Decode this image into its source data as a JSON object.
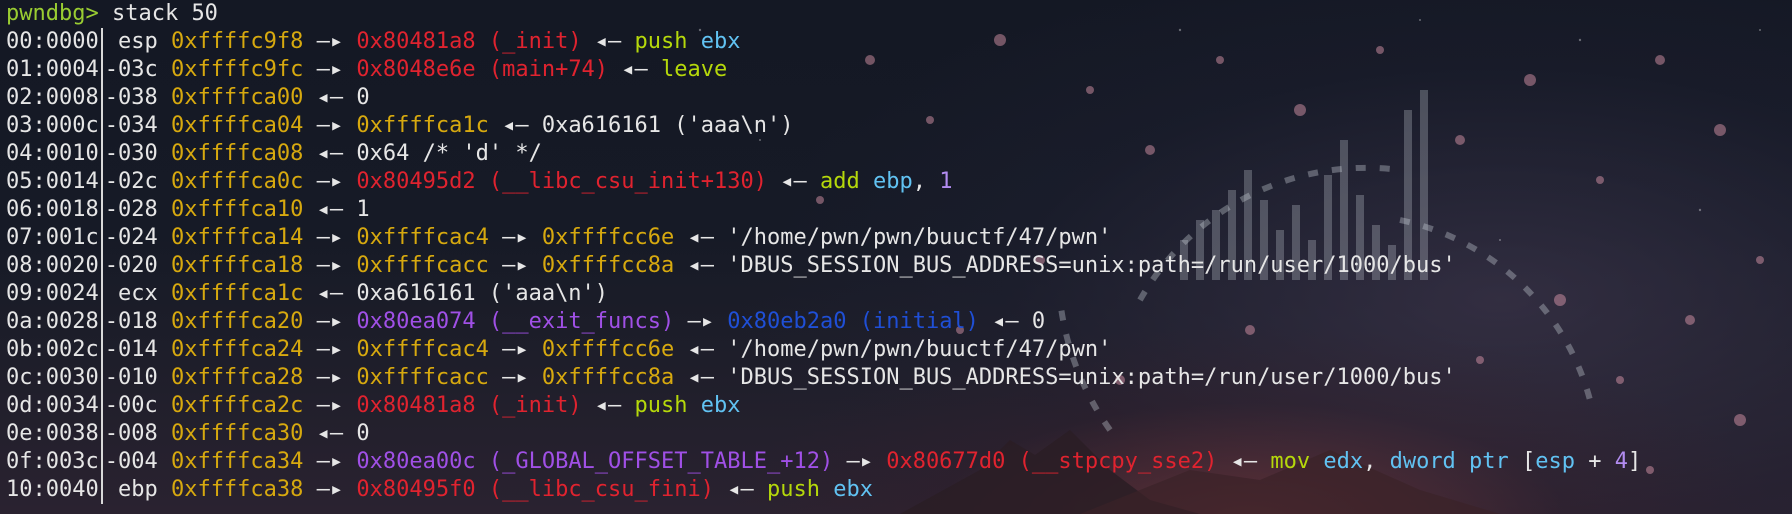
{
  "prompt": {
    "label": "pwndbg>",
    "command": "stack 50"
  },
  "rows": [
    {
      "idx": "00:0000",
      "off": " esp",
      "addr": "0xffffc9f8",
      "parts": [
        {
          "t": " —▸ ",
          "c": "white"
        },
        {
          "t": "0x80481a8 (_init)",
          "c": "red"
        },
        {
          "t": " ◂— ",
          "c": "white"
        },
        {
          "t": "push",
          "c": "lime"
        },
        {
          "t": " ",
          "c": "white"
        },
        {
          "t": "ebx",
          "c": "cyan"
        }
      ]
    },
    {
      "idx": "01:0004",
      "off": "-03c",
      "addr": "0xffffc9fc",
      "parts": [
        {
          "t": " —▸ ",
          "c": "white"
        },
        {
          "t": "0x8048e6e (main+74)",
          "c": "red"
        },
        {
          "t": " ◂— ",
          "c": "white"
        },
        {
          "t": "leave",
          "c": "lime"
        }
      ]
    },
    {
      "idx": "02:0008",
      "off": "-038",
      "addr": "0xffffca00",
      "parts": [
        {
          "t": " ◂— 0",
          "c": "white"
        }
      ]
    },
    {
      "idx": "03:000c",
      "off": "-034",
      "addr": "0xffffca04",
      "parts": [
        {
          "t": " —▸ ",
          "c": "white"
        },
        {
          "t": "0xffffca1c",
          "c": "yellow"
        },
        {
          "t": " ◂— 0xa616161 ('aaa\\n')",
          "c": "white"
        }
      ]
    },
    {
      "idx": "04:0010",
      "off": "-030",
      "addr": "0xffffca08",
      "parts": [
        {
          "t": " ◂— 0x64 /* 'd' */",
          "c": "white"
        }
      ]
    },
    {
      "idx": "05:0014",
      "off": "-02c",
      "addr": "0xffffca0c",
      "parts": [
        {
          "t": " —▸ ",
          "c": "white"
        },
        {
          "t": "0x80495d2 (__libc_csu_init+130)",
          "c": "red"
        },
        {
          "t": " ◂— ",
          "c": "white"
        },
        {
          "t": "add",
          "c": "lime"
        },
        {
          "t": " ",
          "c": "white"
        },
        {
          "t": "ebp",
          "c": "cyan"
        },
        {
          "t": ", ",
          "c": "white"
        },
        {
          "t": "1",
          "c": "lav"
        }
      ]
    },
    {
      "idx": "06:0018",
      "off": "-028",
      "addr": "0xffffca10",
      "parts": [
        {
          "t": " ◂— 1",
          "c": "white"
        }
      ]
    },
    {
      "idx": "07:001c",
      "off": "-024",
      "addr": "0xffffca14",
      "parts": [
        {
          "t": " —▸ ",
          "c": "white"
        },
        {
          "t": "0xffffcac4",
          "c": "yellow"
        },
        {
          "t": " —▸ ",
          "c": "white"
        },
        {
          "t": "0xffffcc6e",
          "c": "yellow"
        },
        {
          "t": " ◂— '/home/pwn/pwn/buuctf/47/pwn'",
          "c": "white"
        }
      ]
    },
    {
      "idx": "08:0020",
      "off": "-020",
      "addr": "0xffffca18",
      "parts": [
        {
          "t": " —▸ ",
          "c": "white"
        },
        {
          "t": "0xffffcacc",
          "c": "yellow"
        },
        {
          "t": " —▸ ",
          "c": "white"
        },
        {
          "t": "0xffffcc8a",
          "c": "yellow"
        },
        {
          "t": " ◂— 'DBUS_SESSION_BUS_ADDRESS=unix:path=/run/user/1000/bus'",
          "c": "white"
        }
      ]
    },
    {
      "idx": "09:0024",
      "off": " ecx",
      "addr": "0xffffca1c",
      "parts": [
        {
          "t": " ◂— 0xa616161 ('aaa\\n')",
          "c": "white"
        }
      ]
    },
    {
      "idx": "0a:0028",
      "off": "-018",
      "addr": "0xffffca20",
      "parts": [
        {
          "t": " —▸ ",
          "c": "white"
        },
        {
          "t": "0x80ea074 (__exit_funcs)",
          "c": "purple"
        },
        {
          "t": " —▸ ",
          "c": "white"
        },
        {
          "t": "0x80eb2a0 (initial)",
          "c": "blue"
        },
        {
          "t": " ◂— 0",
          "c": "white"
        }
      ]
    },
    {
      "idx": "0b:002c",
      "off": "-014",
      "addr": "0xffffca24",
      "parts": [
        {
          "t": " —▸ ",
          "c": "white"
        },
        {
          "t": "0xffffcac4",
          "c": "yellow"
        },
        {
          "t": " —▸ ",
          "c": "white"
        },
        {
          "t": "0xffffcc6e",
          "c": "yellow"
        },
        {
          "t": " ◂— '/home/pwn/pwn/buuctf/47/pwn'",
          "c": "white"
        }
      ]
    },
    {
      "idx": "0c:0030",
      "off": "-010",
      "addr": "0xffffca28",
      "parts": [
        {
          "t": " —▸ ",
          "c": "white"
        },
        {
          "t": "0xffffcacc",
          "c": "yellow"
        },
        {
          "t": " —▸ ",
          "c": "white"
        },
        {
          "t": "0xffffcc8a",
          "c": "yellow"
        },
        {
          "t": " ◂— 'DBUS_SESSION_BUS_ADDRESS=unix:path=/run/user/1000/bus'",
          "c": "white"
        }
      ]
    },
    {
      "idx": "0d:0034",
      "off": "-00c",
      "addr": "0xffffca2c",
      "parts": [
        {
          "t": " —▸ ",
          "c": "white"
        },
        {
          "t": "0x80481a8 (_init)",
          "c": "red"
        },
        {
          "t": " ◂— ",
          "c": "white"
        },
        {
          "t": "push",
          "c": "lime"
        },
        {
          "t": " ",
          "c": "white"
        },
        {
          "t": "ebx",
          "c": "cyan"
        }
      ]
    },
    {
      "idx": "0e:0038",
      "off": "-008",
      "addr": "0xffffca30",
      "parts": [
        {
          "t": " ◂— 0",
          "c": "white"
        }
      ]
    },
    {
      "idx": "0f:003c",
      "off": "-004",
      "addr": "0xffffca34",
      "parts": [
        {
          "t": " —▸ ",
          "c": "white"
        },
        {
          "t": "0x80ea00c (_GLOBAL_OFFSET_TABLE_+12)",
          "c": "purple"
        },
        {
          "t": " —▸ ",
          "c": "white"
        },
        {
          "t": "0x80677d0 (__stpcpy_sse2)",
          "c": "red"
        },
        {
          "t": " ◂— ",
          "c": "white"
        },
        {
          "t": "mov",
          "c": "lime"
        },
        {
          "t": " ",
          "c": "white"
        },
        {
          "t": "edx",
          "c": "cyan"
        },
        {
          "t": ", ",
          "c": "white"
        },
        {
          "t": "dword ptr",
          "c": "cyan"
        },
        {
          "t": " [",
          "c": "white"
        },
        {
          "t": "esp",
          "c": "cyan"
        },
        {
          "t": " + ",
          "c": "white"
        },
        {
          "t": "4",
          "c": "lav"
        },
        {
          "t": "]",
          "c": "white"
        }
      ]
    },
    {
      "idx": "10:0040",
      "off": " ebp",
      "addr": "0xffffca38",
      "parts": [
        {
          "t": " —▸ ",
          "c": "white"
        },
        {
          "t": "0x80495f0 (__libc_csu_fini)",
          "c": "red"
        },
        {
          "t": " ◂— ",
          "c": "white"
        },
        {
          "t": "push",
          "c": "lime"
        },
        {
          "t": " ",
          "c": "white"
        },
        {
          "t": "ebx",
          "c": "cyan"
        }
      ]
    }
  ],
  "colors": {
    "prompt": "#9acd32",
    "address": "#d7a90f",
    "code": "#e0232f",
    "data": "#a050e6",
    "heap": "#1f4fd6",
    "instruction": "#b5d80b",
    "register": "#61c2f2",
    "number": "#b28cf0"
  }
}
